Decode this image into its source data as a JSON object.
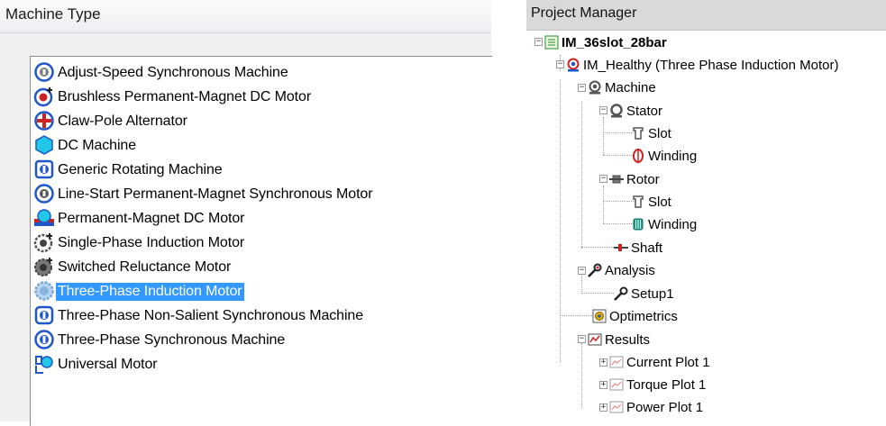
{
  "left_panel": {
    "title": "Machine Type",
    "items": [
      {
        "label": "Adjust-Speed  Synchronous Machine",
        "icon": "synchronous-machine-icon"
      },
      {
        "label": "Brushless Permanent-Magnet DC Motor",
        "icon": "brushless-pm-dc-icon"
      },
      {
        "label": "Claw-Pole Alternator",
        "icon": "claw-pole-icon"
      },
      {
        "label": "DC Machine",
        "icon": "dc-machine-icon"
      },
      {
        "label": "Generic Rotating Machine",
        "icon": "generic-rotating-icon"
      },
      {
        "label": "Line-Start Permanent-Magnet Synchronous Motor",
        "icon": "line-start-pm-icon"
      },
      {
        "label": "Permanent-Magnet DC Motor",
        "icon": "pm-dc-motor-icon"
      },
      {
        "label": "Single-Phase Induction Motor",
        "icon": "single-phase-induction-icon"
      },
      {
        "label": "Switched Reluctance Motor",
        "icon": "switched-reluctance-icon"
      },
      {
        "label": "Three-Phase Induction Motor",
        "icon": "three-phase-induction-icon",
        "selected": true
      },
      {
        "label": "Three-Phase Non-Salient Synchronous Machine",
        "icon": "non-salient-synchronous-icon"
      },
      {
        "label": "Three-Phase Synchronous Machine",
        "icon": "three-phase-synchronous-icon"
      },
      {
        "label": "Universal Motor",
        "icon": "universal-motor-icon"
      }
    ]
  },
  "right_panel": {
    "title": "Project Manager",
    "tree": {
      "project": "IM_36slot_28bar",
      "design": "IM_Healthy (Three Phase Induction Motor)",
      "machine": "Machine",
      "stator": "Stator",
      "stator_slot": "Slot",
      "stator_winding": "Winding",
      "rotor": "Rotor",
      "rotor_slot": "Slot",
      "rotor_winding": "Winding",
      "shaft": "Shaft",
      "analysis": "Analysis",
      "setup": "Setup1",
      "optimetrics": "Optimetrics",
      "results": "Results",
      "plots": [
        "Current Plot 1",
        "Torque Plot 1",
        "Power Plot 1"
      ]
    }
  },
  "colors": {
    "selection": "#3399ff",
    "accent_blue": "#1f57c9",
    "accent_red": "#cc2222"
  }
}
